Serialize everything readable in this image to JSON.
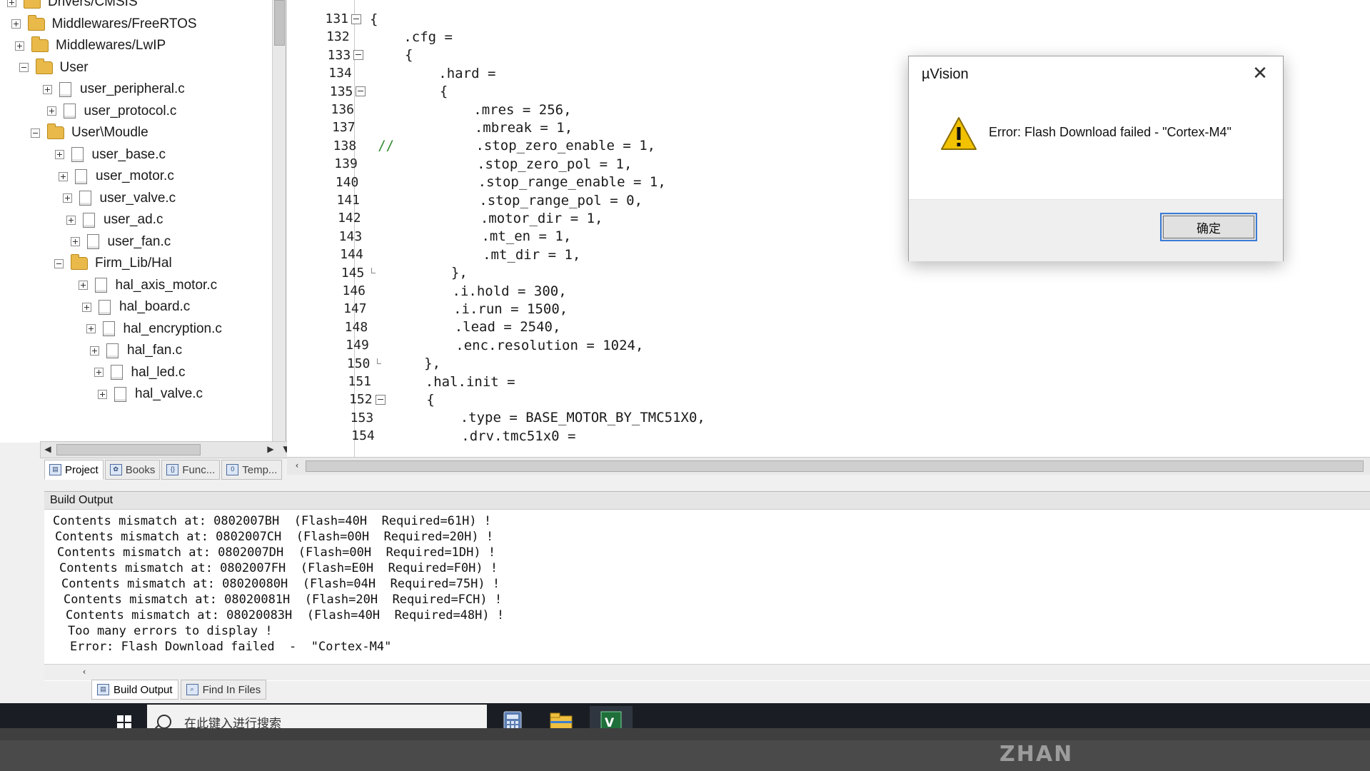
{
  "project_tree": {
    "items": [
      {
        "label": "Drivers/CMSIS",
        "kind": "folder",
        "expander": "plus",
        "level": 0
      },
      {
        "label": "Middlewares/FreeRTOS",
        "kind": "folder",
        "expander": "plus",
        "level": 0
      },
      {
        "label": "Middlewares/LwIP",
        "kind": "folder",
        "expander": "plus",
        "level": 0
      },
      {
        "label": "User",
        "kind": "folder",
        "expander": "minus",
        "level": 0
      },
      {
        "label": "user_peripheral.c",
        "kind": "file",
        "expander": "plus",
        "level": 1
      },
      {
        "label": "user_protocol.c",
        "kind": "file",
        "expander": "plus",
        "level": 1
      },
      {
        "label": "User\\Moudle",
        "kind": "folder",
        "expander": "minus",
        "level": 0
      },
      {
        "label": "user_base.c",
        "kind": "file",
        "expander": "plus",
        "level": 1
      },
      {
        "label": "user_motor.c",
        "kind": "file",
        "expander": "plus",
        "level": 1
      },
      {
        "label": "user_valve.c",
        "kind": "file",
        "expander": "plus",
        "level": 1
      },
      {
        "label": "user_ad.c",
        "kind": "file",
        "expander": "plus",
        "level": 1
      },
      {
        "label": "user_fan.c",
        "kind": "file",
        "expander": "plus",
        "level": 1
      },
      {
        "label": "Firm_Lib/Hal",
        "kind": "folder",
        "expander": "minus",
        "level": 0
      },
      {
        "label": "hal_axis_motor.c",
        "kind": "file",
        "expander": "plus",
        "level": 1
      },
      {
        "label": "hal_board.c",
        "kind": "file",
        "expander": "plus",
        "level": 1
      },
      {
        "label": "hal_encryption.c",
        "kind": "file",
        "expander": "plus",
        "level": 1
      },
      {
        "label": "hal_fan.c",
        "kind": "file",
        "expander": "plus",
        "level": 1
      },
      {
        "label": "hal_led.c",
        "kind": "file",
        "expander": "plus",
        "level": 1
      },
      {
        "label": "hal_valve.c",
        "kind": "file",
        "expander": "plus",
        "level": 1
      }
    ]
  },
  "panel_tabs": [
    {
      "label": "Project",
      "icon": "project-icon",
      "active": true
    },
    {
      "label": "Books",
      "icon": "books-icon",
      "active": false
    },
    {
      "label": "Func...",
      "icon": "braces-icon",
      "active": false
    },
    {
      "label": "Temp...",
      "icon": "template-icon",
      "active": false
    }
  ],
  "editor": {
    "lines": [
      {
        "n": "131",
        "fold": "box",
        "code": "{"
      },
      {
        "n": "132",
        "fold": "",
        "code": "    .cfg ="
      },
      {
        "n": "133",
        "fold": "box",
        "code": "    {"
      },
      {
        "n": "134",
        "fold": "",
        "code": "        .hard ="
      },
      {
        "n": "135",
        "fold": "box",
        "code": "        {"
      },
      {
        "n": "136",
        "fold": "",
        "code": "            .mres = 256,"
      },
      {
        "n": "137",
        "fold": "",
        "code": "            .mbreak = 1,"
      },
      {
        "n": "138",
        "fold": "",
        "comment": "//",
        "code": "          .stop_zero_enable = 1,"
      },
      {
        "n": "139",
        "fold": "",
        "code": "            .stop_zero_pol = 1,"
      },
      {
        "n": "140",
        "fold": "",
        "code": "            .stop_range_enable = 1,"
      },
      {
        "n": "141",
        "fold": "",
        "code": "            .stop_range_pol = 0,"
      },
      {
        "n": "142",
        "fold": "",
        "code": "            .motor_dir = 1,"
      },
      {
        "n": "143",
        "fold": "",
        "code": "            .mt_en = 1,"
      },
      {
        "n": "144",
        "fold": "",
        "code": "            .mt_dir = 1,"
      },
      {
        "n": "145",
        "fold": "end",
        "code": "        },"
      },
      {
        "n": "146",
        "fold": "",
        "code": "        .i.hold = 300,"
      },
      {
        "n": "147",
        "fold": "",
        "code": "        .i.run = 1500,"
      },
      {
        "n": "148",
        "fold": "",
        "code": "        .lead = 2540,"
      },
      {
        "n": "149",
        "fold": "",
        "code": "        .enc.resolution = 1024,"
      },
      {
        "n": "150",
        "fold": "end",
        "code": "    },"
      },
      {
        "n": "151",
        "fold": "",
        "code": "    .hal.init ="
      },
      {
        "n": "152",
        "fold": "box",
        "code": "    {"
      },
      {
        "n": "153",
        "fold": "",
        "code": "        .type = BASE_MOTOR_BY_TMC51X0,"
      },
      {
        "n": "154",
        "fold": "",
        "code": "        .drv.tmc51x0 ="
      }
    ]
  },
  "build_output": {
    "title": "Build Output",
    "lines": [
      "Contents mismatch at: 0802007BH  (Flash=40H  Required=61H) !",
      "Contents mismatch at: 0802007CH  (Flash=00H  Required=20H) !",
      "Contents mismatch at: 0802007DH  (Flash=00H  Required=1DH) !",
      "Contents mismatch at: 0802007FH  (Flash=E0H  Required=F0H) !",
      "Contents mismatch at: 08020080H  (Flash=04H  Required=75H) !",
      "Contents mismatch at: 08020081H  (Flash=20H  Required=FCH) !",
      "Contents mismatch at: 08020083H  (Flash=40H  Required=48H) !",
      "Too many errors to display !",
      "Error: Flash Download failed  -  \"Cortex-M4\""
    ]
  },
  "bottom_tabs": [
    {
      "label": "Build Output",
      "icon": "build-output-icon",
      "active": true
    },
    {
      "label": "Find In Files",
      "icon": "find-in-files-icon",
      "active": false
    }
  ],
  "dialog": {
    "title": "µVision",
    "message": "Error: Flash Download failed  -  \"Cortex-M4\"",
    "ok_label": "确定",
    "icon": "warning-icon"
  },
  "taskbar": {
    "search_placeholder": "在此键入进行搜索",
    "apps": [
      "calculator-icon",
      "file-explorer-icon",
      "keil-uvision-icon"
    ]
  },
  "bezel": {
    "brand": "ZHAN"
  },
  "colors": {
    "accent": "#3a7bd5",
    "taskbar": "#1a1e24",
    "warning": "#f2c200",
    "comment": "#2f8a2f"
  }
}
